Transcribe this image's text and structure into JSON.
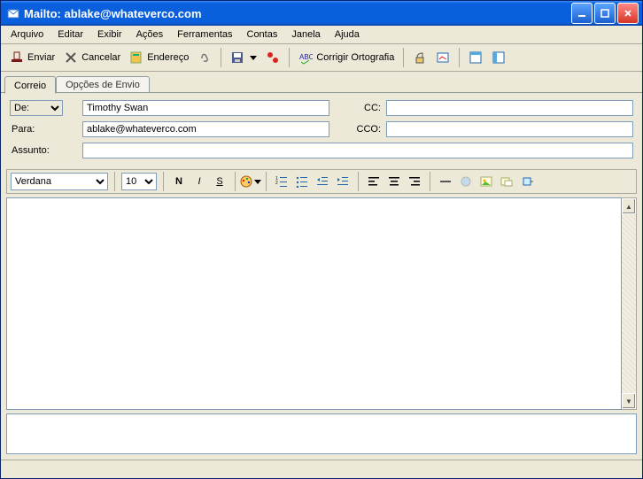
{
  "window": {
    "title": "Mailto: ablake@whateverco.com"
  },
  "menu": {
    "items": [
      "Arquivo",
      "Editar",
      "Exibir",
      "Ações",
      "Ferramentas",
      "Contas",
      "Janela",
      "Ajuda"
    ]
  },
  "toolbar": {
    "send": "Enviar",
    "cancel": "Cancelar",
    "address": "Endereço",
    "spell": "Corrigir Ortografia"
  },
  "tabs": {
    "active": "Correio",
    "inactive": "Opções de Envio"
  },
  "headers": {
    "from_label": "De:",
    "from_value": "Timothy Swan",
    "to_label": "Para:",
    "to_value": "ablake@whateverco.com",
    "cc_label": "CC:",
    "cc_value": "",
    "bcc_label": "CCO:",
    "bcc_value": "",
    "subject_label": "Assunto:",
    "subject_value": ""
  },
  "format": {
    "font": "Verdana",
    "size": "10"
  }
}
